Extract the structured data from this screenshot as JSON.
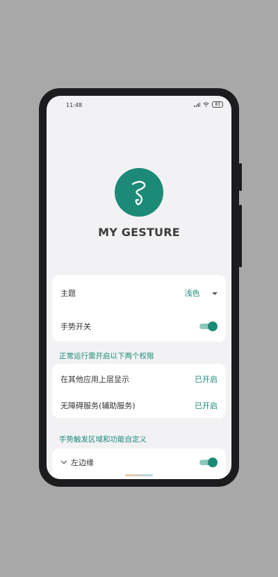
{
  "status_bar": {
    "time": "11:48",
    "battery": "83"
  },
  "app": {
    "title": "MY GESTURE",
    "logo_icon": "gesture-s-logo",
    "accent_color": "#1b8a78"
  },
  "settings": {
    "theme_label": "主题",
    "theme_value": "浅色",
    "gesture_switch_label": "手势开关",
    "gesture_switch_on": true
  },
  "permissions": {
    "section_title": "正常运行需开启以下两个权限",
    "items": [
      {
        "label": "在其他应用上层显示",
        "status": "已开启"
      },
      {
        "label": "无障碍服务(辅助服务)",
        "status": "已开启"
      }
    ]
  },
  "zones": {
    "section_title": "手势触发区域和功能自定义",
    "left_edge_label": "左边缘",
    "left_edge_on": true
  }
}
